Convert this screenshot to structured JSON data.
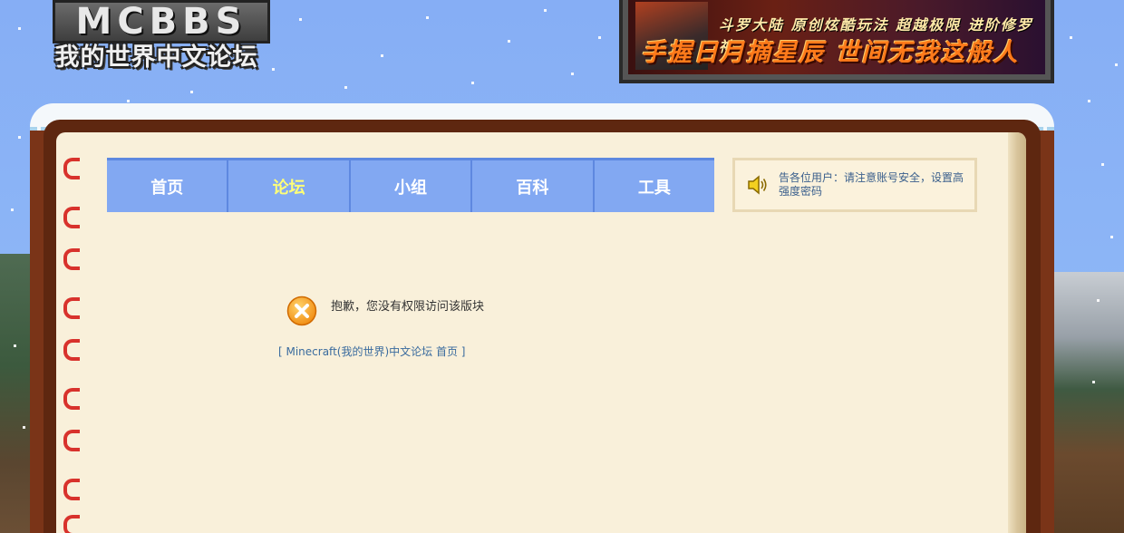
{
  "logo": {
    "top_text": "MCBBS",
    "bottom_text": "我的世界中文论坛"
  },
  "banner": {
    "line1": "斗罗大陆  原创炫酷玩法  超越极限  进阶修罗神",
    "line2": "手握日月摘星辰  世间无我这般人"
  },
  "nav": {
    "items": [
      {
        "label": "首页"
      },
      {
        "label": "论坛"
      },
      {
        "label": "小组"
      },
      {
        "label": "百科"
      },
      {
        "label": "工具"
      }
    ],
    "active_color": "#ffff77"
  },
  "notice": {
    "text": "告各位用户：请注意账号安全，设置高强度密码",
    "icon": "speaker-icon"
  },
  "message": {
    "icon": "error-x-icon",
    "text": "抱歉，您没有权限访问该版块",
    "link_text": "[ Minecraft(我的世界)中文论坛 首页 ]"
  },
  "colors": {
    "nav_bg": "#82a8f2",
    "page_bg": "#f9f0da",
    "frame": "#7a3418",
    "link": "#3a6b9e"
  }
}
